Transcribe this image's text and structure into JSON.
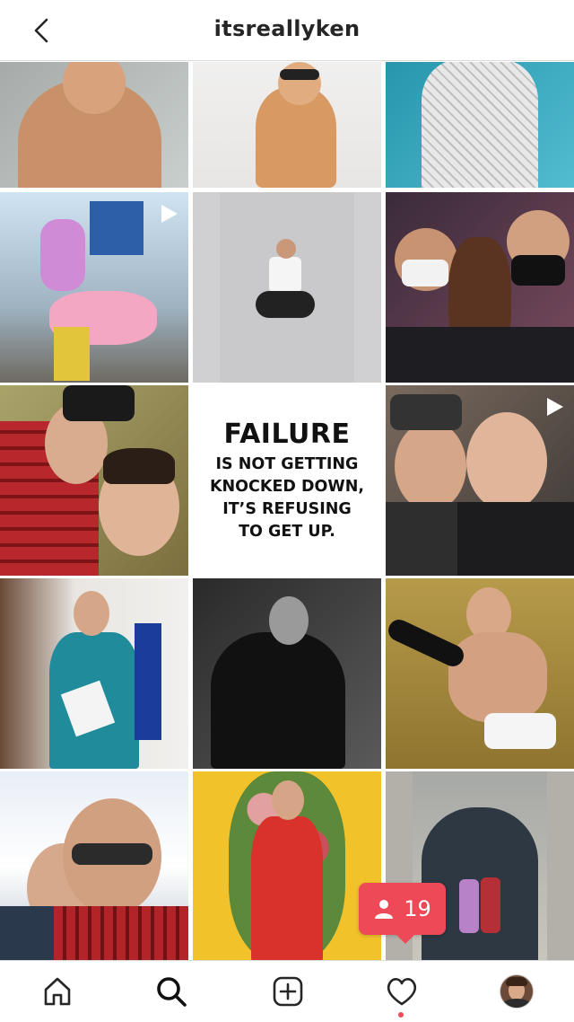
{
  "header": {
    "title": "itsreallyken",
    "back_icon": "chevron-left-icon"
  },
  "grid": {
    "quote_post": {
      "headline": "FAILURE",
      "lines": [
        "IS NOT GETTING",
        "KNOCKED DOWN,",
        "IT’S REFUSING",
        "TO GET UP."
      ]
    },
    "photos": [
      {
        "name": "shirtless-man-photo",
        "video": false
      },
      {
        "name": "masked-shirtless-man-photo",
        "video": false
      },
      {
        "name": "white-dress-photo",
        "video": false
      },
      {
        "name": "carousel-horse-photo",
        "video": true
      },
      {
        "name": "jumping-man-collage-photo",
        "video": false
      },
      {
        "name": "group-masks-photo",
        "video": false
      },
      {
        "name": "couple-selfie-photo",
        "video": false
      },
      {
        "name": "couple-indoor-selfie-photo",
        "video": true
      },
      {
        "name": "blue-suit-photo",
        "video": false
      },
      {
        "name": "leather-jacket-bw-photo",
        "video": false
      },
      {
        "name": "couch-underwear-photo",
        "video": false
      },
      {
        "name": "snow-selfie-photo",
        "video": false
      },
      {
        "name": "floral-red-suit-photo",
        "video": false
      },
      {
        "name": "castle-door-couple-photo",
        "video": false
      }
    ]
  },
  "likes_badge": {
    "count": "19",
    "icon": "person-icon",
    "color": "#ed4956"
  },
  "navbar": {
    "items": [
      "home-icon",
      "search-icon",
      "add-post-icon",
      "heart-icon",
      "profile-avatar"
    ],
    "notification_dot_color": "#ed4956"
  }
}
